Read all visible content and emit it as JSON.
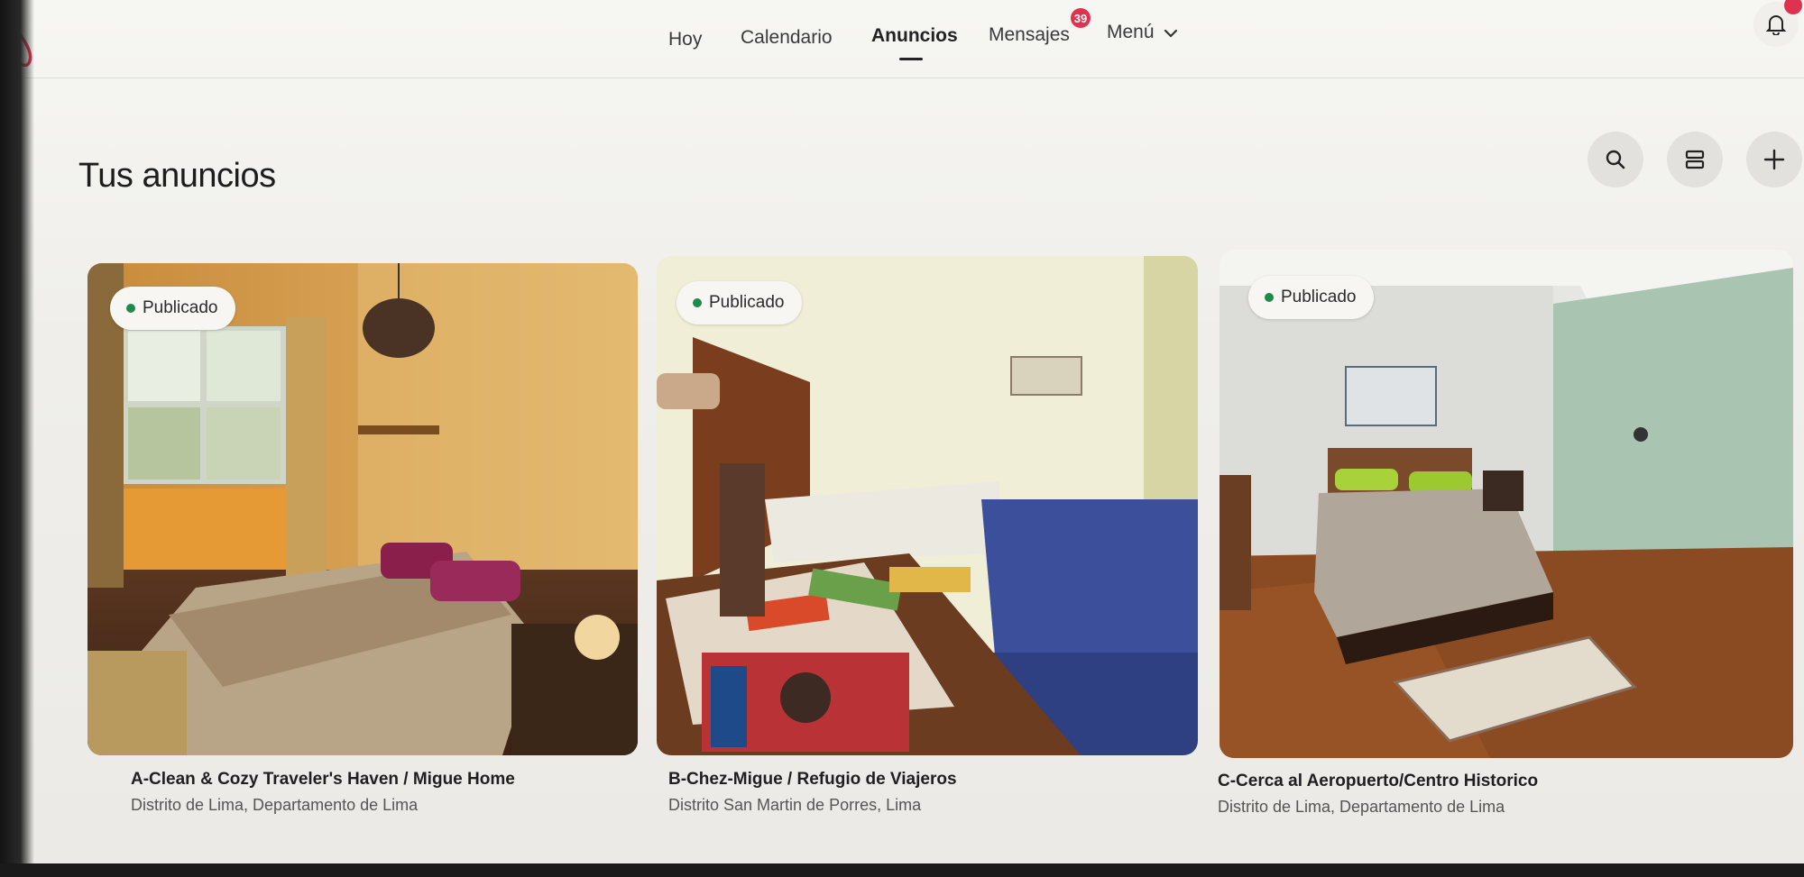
{
  "nav": {
    "items": [
      {
        "label": "Hoy"
      },
      {
        "label": "Calendario"
      },
      {
        "label": "Anuncios"
      },
      {
        "label": "Mensajes"
      },
      {
        "label": "Menú"
      }
    ],
    "messages_badge": "39",
    "active": "Anuncios"
  },
  "icons": {
    "logo": "airbnb-logo-icon",
    "bell": "bell-icon",
    "search": "search-icon",
    "view": "list-view-icon",
    "add": "plus-icon",
    "menu_chevron": "chevron-down-icon"
  },
  "page": {
    "title": "Tus anuncios"
  },
  "listings": [
    {
      "status": "Publicado",
      "title": "A-Clean & Cozy Traveler's Haven / Migue Home",
      "location": "Distrito de Lima, Departamento de Lima"
    },
    {
      "status": "Publicado",
      "title": "B-Chez-Migue / Refugio de Viajeros",
      "location": "Distrito San Martin de Porres, Lima"
    },
    {
      "status": "Publicado",
      "title": "C-Cerca al Aeropuerto/Centro Historico",
      "location": "Distrito de Lima, Departamento de Lima"
    }
  ],
  "colors": {
    "brand": "#e0314f",
    "published_dot": "#1f8a4c"
  }
}
